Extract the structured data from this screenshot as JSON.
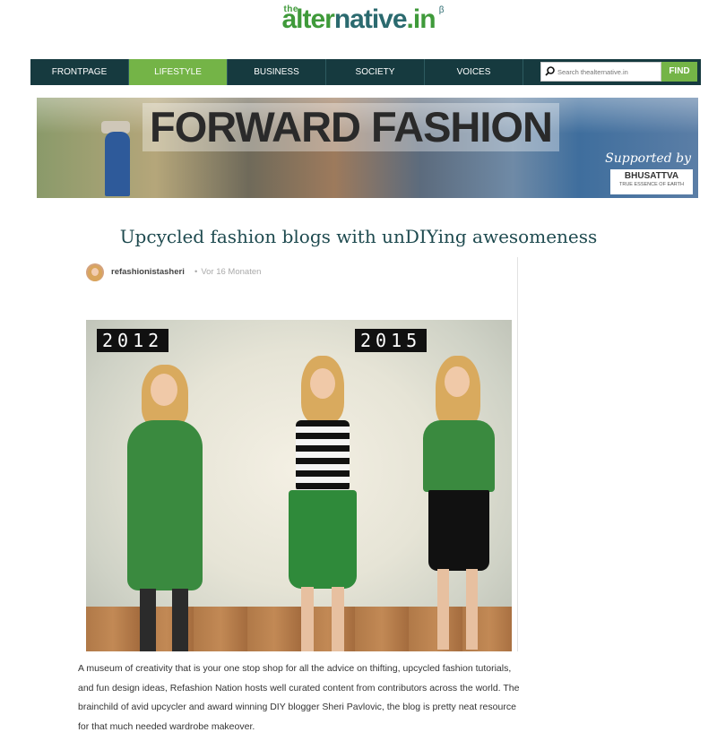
{
  "logo": {
    "small": "the",
    "main_green": "alter",
    "main_dark": "native",
    "main_suffix": ".in",
    "beta": "β"
  },
  "nav": {
    "items": [
      {
        "label": "FRONTPAGE",
        "active": false
      },
      {
        "label": "LIFESTYLE",
        "active": true
      },
      {
        "label": "BUSINESS",
        "active": false
      },
      {
        "label": "SOCIETY",
        "active": false
      },
      {
        "label": "VOICES",
        "active": false
      }
    ],
    "search_placeholder": "Search thealternative.in",
    "find_label": "FIND",
    "active_color": "#74b447",
    "bar_color": "#163a3f"
  },
  "banner": {
    "title": "FORWARD FASHION",
    "supported_by": "Supported by",
    "brand": "BHUSATTVA",
    "brand_tagline": "TRUE ESSENCE OF EARTH"
  },
  "headline": "Upcycled fashion blogs with unDIYing awesomeness",
  "embed": {
    "username": "refashionistasheri",
    "separator": "•",
    "time": "Vor 16 Monaten",
    "photo": {
      "year_left": "2012",
      "year_right": "2015"
    }
  },
  "description": "A museum of creativity that is your one stop shop for all the advice on thifting, upcycled fashion tutorials, and fun design ideas, Refashion Nation hosts well curated content from contributors across the world. The brainchild of avid upcycler and award winning DIY blogger Sheri Pavlovic, the blog is pretty neat resource for that much needed wardrobe makeover."
}
